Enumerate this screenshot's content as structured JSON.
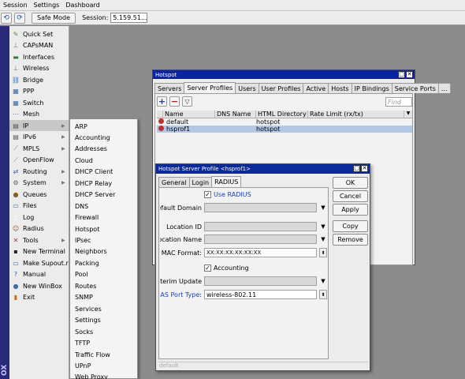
{
  "menubar": {
    "items": [
      "Session",
      "Settings",
      "Dashboard"
    ]
  },
  "toolbar": {
    "safe_mode": "Safe Mode",
    "session_label": "Session:",
    "session_value": "5.159.51..."
  },
  "vertical_label": "OX",
  "sidebar": {
    "items": [
      {
        "label": "Quick Set",
        "icon": "quick-set-icon",
        "color": "#5a8a2a",
        "glyph": "✎"
      },
      {
        "label": "CAPsMAN",
        "icon": "capsman-icon",
        "color": "#777777",
        "glyph": "⊥"
      },
      {
        "label": "Interfaces",
        "icon": "interfaces-icon",
        "color": "#2f7d2f",
        "glyph": "▬"
      },
      {
        "label": "Wireless",
        "icon": "wireless-icon",
        "color": "#777777",
        "glyph": "⊥"
      },
      {
        "label": "Bridge",
        "icon": "bridge-icon",
        "color": "#2a6ab8",
        "glyph": "⛓"
      },
      {
        "label": "PPP",
        "icon": "ppp-icon",
        "color": "#3d6ab0",
        "glyph": "▦"
      },
      {
        "label": "Switch",
        "icon": "switch-icon",
        "color": "#3d6ab0",
        "glyph": "▦"
      },
      {
        "label": "Mesh",
        "icon": "mesh-icon",
        "color": "#3d6ab0",
        "glyph": "⋯"
      },
      {
        "label": "IP",
        "icon": "ip-icon",
        "color": "#555555",
        "glyph": "▤",
        "arrow": true
      },
      {
        "label": "IPv6",
        "icon": "ipv6-icon",
        "color": "#555555",
        "glyph": "▤",
        "arrow": true
      },
      {
        "label": "MPLS",
        "icon": "mpls-icon",
        "color": "#777777",
        "glyph": "⟋",
        "arrow": true
      },
      {
        "label": "OpenFlow",
        "icon": "openflow-icon",
        "color": "#777777",
        "glyph": "⟋"
      },
      {
        "label": "Routing",
        "icon": "routing-icon",
        "color": "#3d6ab0",
        "glyph": "⇄",
        "arrow": true
      },
      {
        "label": "System",
        "icon": "system-icon",
        "color": "#666666",
        "glyph": "⚙",
        "arrow": true
      },
      {
        "label": "Queues",
        "icon": "queues-icon",
        "color": "#8a5a2a",
        "glyph": "●"
      },
      {
        "label": "Files",
        "icon": "files-icon",
        "color": "#3d6ab0",
        "glyph": "▭"
      },
      {
        "label": "Log",
        "icon": "log-icon",
        "color": "#ffffff",
        "glyph": "▯"
      },
      {
        "label": "Radius",
        "icon": "radius-icon",
        "color": "#8a5a2a",
        "glyph": "☺"
      },
      {
        "label": "Tools",
        "icon": "tools-icon",
        "color": "#b03030",
        "glyph": "✕",
        "arrow": true
      },
      {
        "label": "New Terminal",
        "icon": "terminal-icon",
        "color": "#222222",
        "glyph": "▪"
      },
      {
        "label": "Make Supout.rif",
        "icon": "supout-icon",
        "color": "#3d6ab0",
        "glyph": "▭"
      },
      {
        "label": "Manual",
        "icon": "manual-icon",
        "color": "#1e5fc8",
        "glyph": "?"
      },
      {
        "label": "New WinBox",
        "icon": "winbox-icon",
        "color": "#3d6ab0",
        "glyph": "●"
      },
      {
        "label": "Exit",
        "icon": "exit-icon",
        "color": "#c86a1e",
        "glyph": "▮"
      }
    ]
  },
  "submenu": {
    "items": [
      "ARP",
      "Accounting",
      "Addresses",
      "Cloud",
      "DHCP Client",
      "DHCP Relay",
      "DHCP Server",
      "DNS",
      "Firewall",
      "Hotspot",
      "IPsec",
      "Neighbors",
      "Packing",
      "Pool",
      "Routes",
      "SNMP",
      "Services",
      "Settings",
      "Socks",
      "TFTP",
      "Traffic Flow",
      "UPnP",
      "Web Proxy"
    ]
  },
  "hotspot": {
    "title": "Hotspot",
    "tabs": [
      "Servers",
      "Server Profiles",
      "Users",
      "User Profiles",
      "Active",
      "Hosts",
      "IP Bindings",
      "Service Ports",
      "..."
    ],
    "find_placeholder": "Find",
    "columns": [
      "Name",
      "DNS Name",
      "HTML Directory",
      "Rate Limit (rx/tx)"
    ],
    "rows": [
      {
        "name": "default",
        "dns": "",
        "html": "hotspot",
        "rate": ""
      },
      {
        "name": "hsprof1",
        "dns": "",
        "html": "hotspot",
        "rate": ""
      }
    ]
  },
  "dialog": {
    "title": "Hotspot Server Profile <hsprof1>",
    "tabs": [
      "General",
      "Login",
      "RADIUS"
    ],
    "use_radius": "Use RADIUS",
    "default_domain_label": "Default Domain",
    "location_id_label": "Location ID",
    "location_name_label": "Location Name",
    "mac_format_label": "MAC Format:",
    "mac_format_value": "XX:XX:XX:XX:XX:XX",
    "accounting": "Accounting",
    "interim_update_label": "Interim Update",
    "nas_port_type_label": "NAS Port Type:",
    "nas_port_type_value": "wireless-802.11",
    "buttons": [
      "OK",
      "Cancel",
      "Apply",
      "Copy",
      "Remove"
    ],
    "status": "default",
    "link_color": "#1a3ec8"
  },
  "colors": {
    "title_bar": "#0a24a0",
    "selected_row": "#b4c8e6",
    "dialog_title": "#0a2a9a"
  }
}
